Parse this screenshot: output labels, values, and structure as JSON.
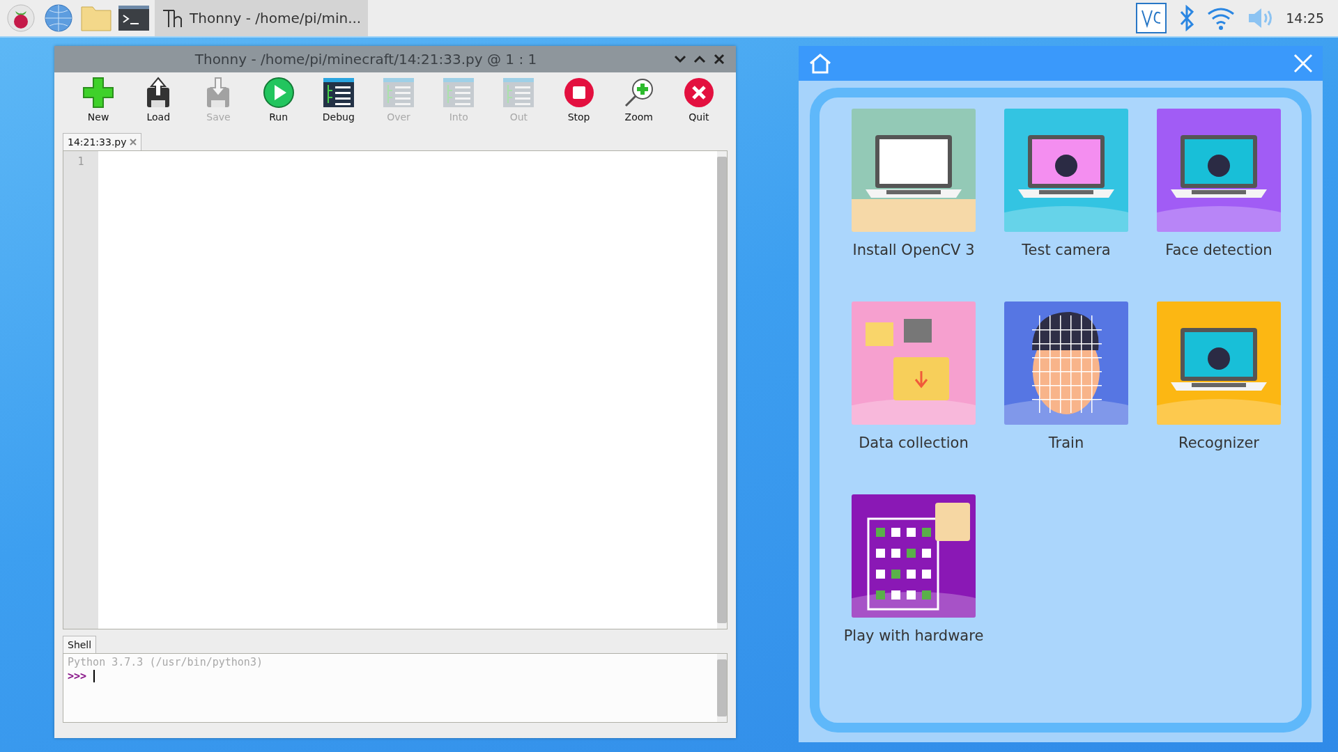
{
  "taskbar": {
    "task": {
      "label": "Thonny  -  /home/pi/min...",
      "selected": true
    },
    "clock": "14:25"
  },
  "thonny": {
    "title": "Thonny  -  /home/pi/minecraft/14:21:33.py  @  1 : 1",
    "toolbar": [
      {
        "label": "New",
        "kind": "new",
        "disabled": false
      },
      {
        "label": "Load",
        "kind": "load",
        "disabled": false
      },
      {
        "label": "Save",
        "kind": "save",
        "disabled": true
      },
      {
        "label": "Run",
        "kind": "run",
        "disabled": false
      },
      {
        "label": "Debug",
        "kind": "debug",
        "disabled": false
      },
      {
        "label": "Over",
        "kind": "over",
        "disabled": true
      },
      {
        "label": "Into",
        "kind": "into",
        "disabled": true
      },
      {
        "label": "Out",
        "kind": "out",
        "disabled": true
      },
      {
        "label": "Stop",
        "kind": "stop",
        "disabled": false
      },
      {
        "label": "Zoom",
        "kind": "zoom",
        "disabled": false
      },
      {
        "label": "Quit",
        "kind": "quit",
        "disabled": false
      }
    ],
    "editor": {
      "tab": {
        "label": "14:21:33.py",
        "selected": true
      },
      "line_numbers": [
        "1"
      ]
    },
    "shell": {
      "tab": {
        "label": "Shell",
        "selected": true
      },
      "banner": "Python 3.7.3 (/usr/bin/python3)",
      "prompt": ">>>"
    }
  },
  "app": {
    "tiles": [
      {
        "label": "Install OpenCV 3",
        "kind": "picture"
      },
      {
        "label": "Test camera",
        "kind": "picture"
      },
      {
        "label": "Face detection",
        "kind": "picture"
      },
      {
        "label": "Data collection",
        "kind": "picture"
      },
      {
        "label": "Train",
        "kind": "picture"
      },
      {
        "label": "Recognizer",
        "kind": "picture"
      },
      {
        "label": "Play with hardware",
        "kind": "picture"
      }
    ]
  }
}
